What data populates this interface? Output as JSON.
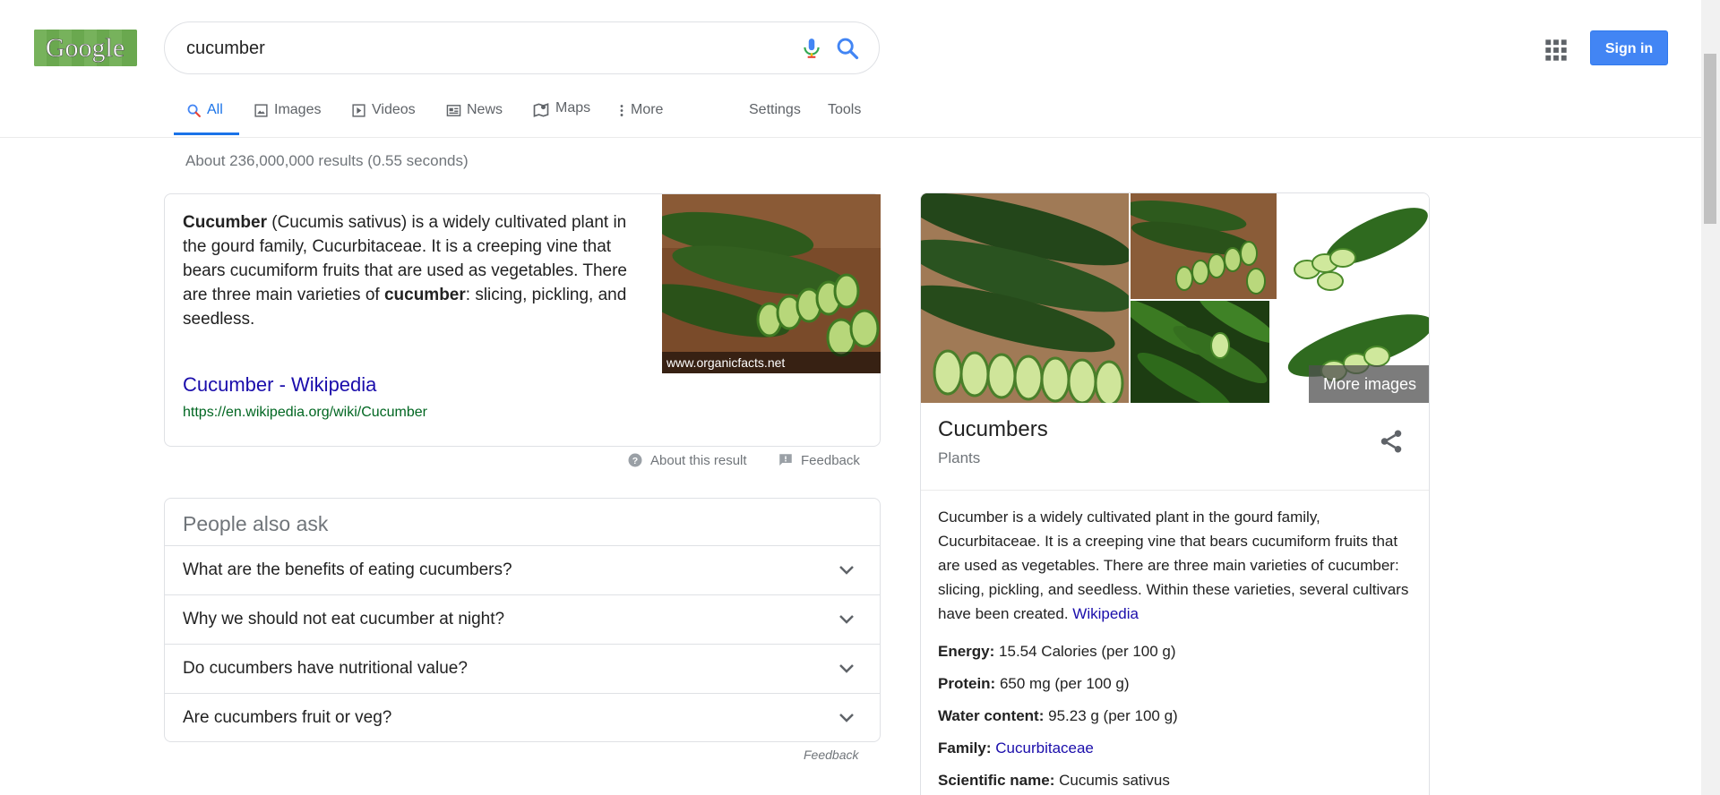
{
  "logo": {
    "text": "Google"
  },
  "search": {
    "value": "cucumber"
  },
  "header": {
    "signin_label": "Sign in"
  },
  "tabs": [
    {
      "label": "All",
      "icon": "search-icon"
    },
    {
      "label": "Images",
      "icon": "image-icon"
    },
    {
      "label": "Videos",
      "icon": "video-icon"
    },
    {
      "label": "News",
      "icon": "news-icon"
    },
    {
      "label": "Maps",
      "icon": "map-icon"
    },
    {
      "label": "More",
      "icon": "more-vert-icon"
    }
  ],
  "tools": {
    "settings": "Settings",
    "tools": "Tools"
  },
  "result_stats": "About 236,000,000 results (0.55 seconds)",
  "snippet": {
    "term": "Cucumber",
    "part1": " (Cucumis sativus) is a widely cultivated plant in the gourd family, Cucurbitaceae. It is a creeping vine that bears cucumiform fruits that are used as vegetables. There are three main varieties of ",
    "term2": "cucumber",
    "part2": ": slicing, pickling, and seedless.",
    "image_caption": "www.organicfacts.net",
    "link_title": "Cucumber - Wikipedia",
    "link_url": "https://en.wikipedia.org/wiki/Cucumber",
    "about": "About this result",
    "feedback": "Feedback"
  },
  "paa": {
    "title": "People also ask",
    "questions": [
      "What are the benefits of eating cucumbers?",
      "Why we should not eat cucumber at night?",
      "Do cucumbers have nutritional value?",
      "Are cucumbers fruit or veg?"
    ],
    "feedback": "Feedback"
  },
  "knowledge_panel": {
    "more_images": "More images",
    "title": "Cucumbers",
    "subtitle": "Plants",
    "description": "Cucumber is a widely cultivated plant in the gourd family, Cucurbitaceae. It is a creeping vine that bears cucumiform fruits that are used as vegetables. There are three main varieties of cucumber: slicing, pickling, and seedless. Within these varieties, several cultivars have been created.",
    "description_source": "Wikipedia",
    "facts": [
      {
        "label": "Energy:",
        "value": "15.54 Calories (per 100 g)"
      },
      {
        "label": "Protein:",
        "value": "650 mg (per 100 g)"
      },
      {
        "label": "Water content:",
        "value": "95.23 g (per 100 g)"
      },
      {
        "label": "Family:",
        "value": "Cucurbitaceae"
      },
      {
        "label": "Scientific name:",
        "value": "Cucumis sativus"
      }
    ]
  },
  "colors": {
    "accent": "#1a73e8",
    "link": "#1a0dab",
    "url": "#006621",
    "signin": "#4285f4"
  }
}
